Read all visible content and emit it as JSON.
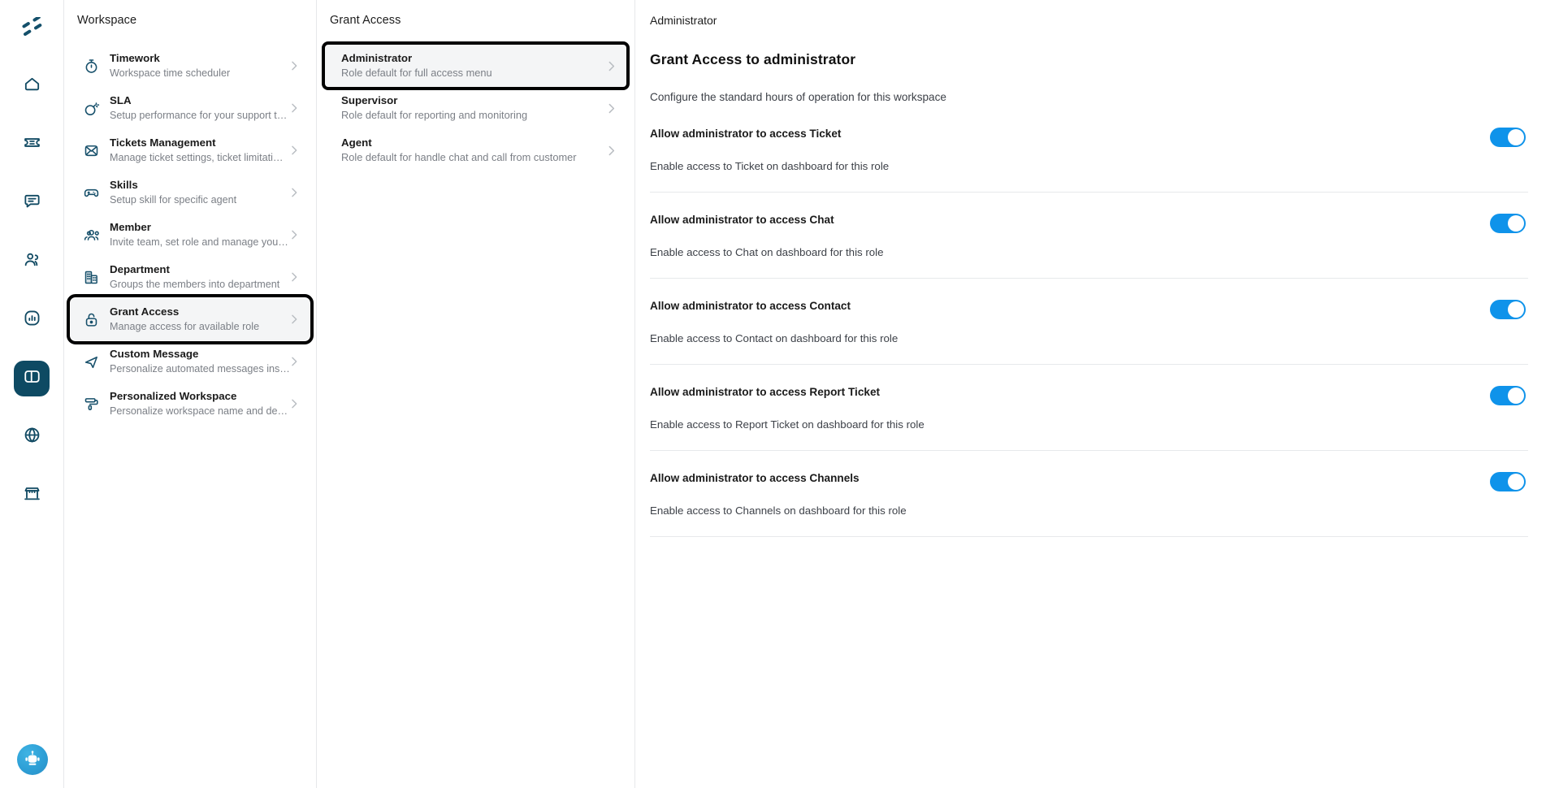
{
  "rail": {
    "logo_icon": "app-logo-icon",
    "items": [
      {
        "icon": "home-icon",
        "name": "rail-item-home",
        "active": false
      },
      {
        "icon": "ticket-icon",
        "name": "rail-item-tickets",
        "active": false
      },
      {
        "icon": "chat-icon",
        "name": "rail-item-chat",
        "active": false
      },
      {
        "icon": "contacts-icon",
        "name": "rail-item-contacts",
        "active": false
      },
      {
        "icon": "report-icon",
        "name": "rail-item-report",
        "active": false
      },
      {
        "icon": "workspace-icon",
        "name": "rail-item-workspace",
        "active": true
      },
      {
        "icon": "globe-icon",
        "name": "rail-item-channels",
        "active": false
      },
      {
        "icon": "store-icon",
        "name": "rail-item-store",
        "active": false
      }
    ],
    "bot_avatar_icon": "robot-avatar-icon"
  },
  "workspace": {
    "title": "Workspace",
    "items": [
      {
        "name": "Timework",
        "desc": "Workspace time scheduler",
        "icon": "stopwatch-icon"
      },
      {
        "name": "SLA",
        "desc": "Setup performance for your support t…",
        "icon": "bomb-icon"
      },
      {
        "name": "Tickets Management",
        "desc": "Manage ticket settings, ticket limitati…",
        "icon": "ticket-envelope-icon"
      },
      {
        "name": "Skills",
        "desc": "Setup skill for specific agent",
        "icon": "gamepad-icon"
      },
      {
        "name": "Member",
        "desc": "Invite team, set role and manage you…",
        "icon": "people-icon"
      },
      {
        "name": "Department",
        "desc": "Groups the members into department",
        "icon": "building-icon"
      },
      {
        "name": "Grant Access",
        "desc": "Manage access for available role",
        "icon": "unlock-icon"
      },
      {
        "name": "Custom Message",
        "desc": "Personalize automated messages ins…",
        "icon": "send-icon"
      },
      {
        "name": "Personalized Workspace",
        "desc": "Personalize workspace name and de…",
        "icon": "paint-roller-icon"
      }
    ],
    "selected_index": 6
  },
  "roles": {
    "title": "Grant Access",
    "items": [
      {
        "name": "Administrator",
        "desc": "Role default for full access menu"
      },
      {
        "name": "Supervisor",
        "desc": "Role default for reporting and monitoring"
      },
      {
        "name": "Agent",
        "desc": "Role default for handle chat and call from customer"
      }
    ],
    "selected_index": 0
  },
  "detail": {
    "breadcrumb": "Administrator",
    "heading": "Grant Access to administrator",
    "subheading": "Configure the standard hours of operation for this workspace",
    "permissions": [
      {
        "title": "Allow administrator to access Ticket",
        "desc": "Enable access to Ticket on dashboard for this role",
        "enabled": true
      },
      {
        "title": "Allow administrator to access Chat",
        "desc": "Enable access to Chat on dashboard for this role",
        "enabled": true
      },
      {
        "title": "Allow administrator to access Contact",
        "desc": "Enable access to Contact on dashboard for this role",
        "enabled": true
      },
      {
        "title": "Allow administrator to access Report Ticket",
        "desc": "Enable access to Report Ticket on dashboard for this role",
        "enabled": true
      },
      {
        "title": "Allow administrator to access Channels",
        "desc": "Enable access to Channels on dashboard for this role",
        "enabled": true
      }
    ]
  },
  "colors": {
    "brand_dark": "#0e4a63",
    "icon_teal": "#17506b",
    "toggle_on": "#0f93ea",
    "selected_row_bg": "#f4f5f6",
    "highlight_outline": "#000000",
    "muted_text": "#7b7f86",
    "divider": "#e6e8ea"
  }
}
